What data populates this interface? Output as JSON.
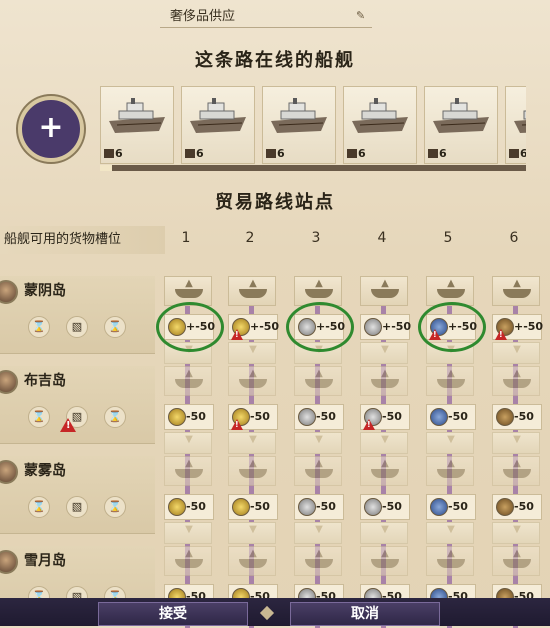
{
  "header": {
    "route_name": "奢侈品供应"
  },
  "ships_section": {
    "title": "这条路在线的船舰",
    "add_label": "+",
    "ships": [
      {
        "level": "6"
      },
      {
        "level": "6"
      },
      {
        "level": "6"
      },
      {
        "level": "6"
      },
      {
        "level": "6"
      },
      {
        "level": "6"
      }
    ]
  },
  "stations_section": {
    "title": "贸易路线站点",
    "slot_label": "船舰可用的货物槽位",
    "columns": [
      "1",
      "2",
      "3",
      "4",
      "5",
      "6"
    ]
  },
  "islands": [
    {
      "name": "蒙阴岛",
      "cargo": [
        {
          "amount": "+-50",
          "icon": "gold-coin",
          "warn": false,
          "highlighted": true
        },
        {
          "amount": "+-50",
          "icon": "gold-coin",
          "warn": true,
          "highlighted": false
        },
        {
          "amount": "+-50",
          "icon": "silver-watch",
          "warn": false,
          "highlighted": true
        },
        {
          "amount": "+-50",
          "icon": "silver-watch",
          "warn": false,
          "highlighted": false
        },
        {
          "amount": "+-50",
          "icon": "blue-clock",
          "warn": true,
          "highlighted": true
        },
        {
          "amount": "+-50",
          "icon": "gramophone",
          "warn": true,
          "highlighted": false
        }
      ]
    },
    {
      "name": "布吉岛",
      "cargo": [
        {
          "amount": "-50",
          "icon": "gold-coin",
          "warn": false
        },
        {
          "amount": "-50",
          "icon": "gold-coin",
          "warn": true
        },
        {
          "amount": "-50",
          "icon": "silver-watch",
          "warn": false
        },
        {
          "amount": "-50",
          "icon": "silver-watch",
          "warn": true
        },
        {
          "amount": "-50",
          "icon": "blue-clock",
          "warn": false
        },
        {
          "amount": "-50",
          "icon": "gramophone",
          "warn": false
        }
      ]
    },
    {
      "name": "蒙雾岛",
      "cargo": [
        {
          "amount": "-50",
          "icon": "gold-coin",
          "warn": false
        },
        {
          "amount": "-50",
          "icon": "gold-coin",
          "warn": false
        },
        {
          "amount": "-50",
          "icon": "silver-watch",
          "warn": false
        },
        {
          "amount": "-50",
          "icon": "silver-watch",
          "warn": false
        },
        {
          "amount": "-50",
          "icon": "blue-clock",
          "warn": false
        },
        {
          "amount": "-50",
          "icon": "gramophone",
          "warn": false
        }
      ]
    },
    {
      "name": "雪月岛",
      "cargo": [
        {
          "amount": "-50",
          "icon": "gold-coin",
          "warn": false
        },
        {
          "amount": "-50",
          "icon": "gold-coin",
          "warn": false
        },
        {
          "amount": "-50",
          "icon": "silver-watch",
          "warn": false
        },
        {
          "amount": "-50",
          "icon": "silver-watch",
          "warn": true
        },
        {
          "amount": "-50",
          "icon": "blue-clock",
          "warn": false
        },
        {
          "amount": "-50",
          "icon": "gramophone",
          "warn": false
        }
      ]
    }
  ],
  "footer": {
    "accept_label": "接受",
    "cancel_label": "取消"
  },
  "colors": {
    "highlight_ring": "#2f8a2f",
    "warning": "#c62626",
    "connector": "#a882a8",
    "button": "#3a3156"
  }
}
